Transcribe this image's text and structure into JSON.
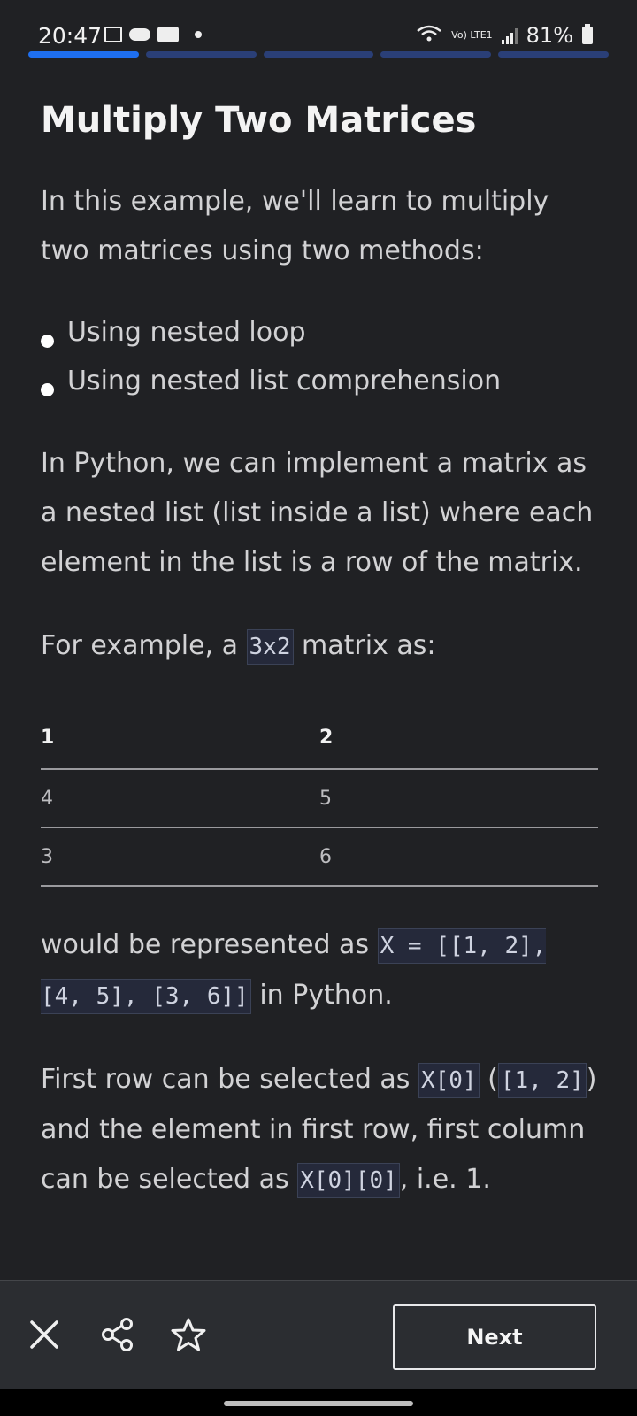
{
  "status": {
    "time": "20:47",
    "volte": "Vo) LTE1",
    "network": "6",
    "battery": "81%"
  },
  "progress": {
    "total_segments": 5,
    "active_segment": 1
  },
  "article": {
    "title": "Multiply Two Matrices",
    "intro": "In this example, we'll learn to multiply two matrices using two methods:",
    "bullets": [
      "Using nested loop",
      "Using nested list comprehension"
    ],
    "para2": "In Python, we can implement a matrix as a nested list (list inside a list) where each element in the list is a row of the matrix.",
    "para3_a": "For example, a ",
    "para3_code": "3x2",
    "para3_b": " matrix as:",
    "table": {
      "headers": [
        "1",
        "2"
      ],
      "rows": [
        [
          "4",
          "5"
        ],
        [
          "3",
          "6"
        ]
      ]
    },
    "para4_a": "would be represented as ",
    "para4_code": "X = [[1, 2], [4, 5], [3, 6]]",
    "para4_b": " in Python.",
    "para5_a": "First row can be selected as ",
    "para5_code1": "X[0]",
    "para5_b": " (",
    "para5_code2": "[1, 2]",
    "para5_c": ") and the element in first row, first column can be selected as ",
    "para5_code3": "X[0][0]",
    "para5_d": ", i.e. 1."
  },
  "bottom": {
    "next_label": "Next",
    "icons": [
      "close-icon",
      "share-icon",
      "star-icon"
    ]
  }
}
